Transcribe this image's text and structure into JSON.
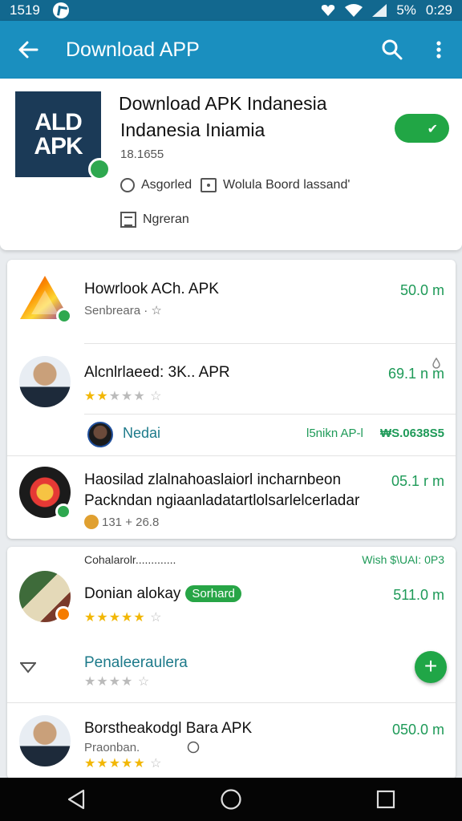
{
  "status_bar": {
    "time_left": "1519",
    "battery": "5%",
    "time_right": "0:29"
  },
  "app_bar": {
    "title": "Download APP",
    "back_icon": "arrow-left-icon",
    "search_icon": "search-icon",
    "menu_icon": "more-vert-icon"
  },
  "header": {
    "logo_line1": "ALD",
    "logo_line2": "APK",
    "title_line1": "Download APK Indanesia",
    "title_line2": "Indanesia Iniamia",
    "count": "18.1655",
    "option1": "Asgorled",
    "option2": "Wolula Boord lassand'",
    "option3": "Ngreran",
    "toggle_state": "on"
  },
  "list1": [
    {
      "title": "Howrlook ACh. APK",
      "subtitle": "Senbreara · ☆",
      "size": "50.0 m"
    },
    {
      "title": "Alcnlrlaeed: 3K.. APR",
      "size": "69.1 n m",
      "rating": 2
    },
    {
      "title": "Nedai",
      "left_tag": "l5nikn AP-l",
      "right_tag": "₩S.0638S5"
    },
    {
      "title": "Haosilad zlalnahoaslaiorl incharnbeon",
      "title2": "Packndan ngiaanladatartlolsarlelcerladar",
      "meta": "131 + 26.8",
      "size": "05.1 r m"
    }
  ],
  "list2": {
    "header_left": "Cohalarolr.............",
    "header_right": "Wish $\\UAI: 0P3",
    "items": [
      {
        "title": "Donian alokay",
        "pill": "Sorhard",
        "size": "511.0 m",
        "rating": 4
      },
      {
        "title": "Penaleeraulera",
        "rating": 0
      },
      {
        "title": "Borstheakodgl Bara APK",
        "subtitle": "Praonban.",
        "size": "050.0 m",
        "rating": 4
      }
    ]
  },
  "colors": {
    "primary": "#1a8fbf",
    "status": "#12688f",
    "accent": "#21a645",
    "size_text": "#1e9a58"
  }
}
